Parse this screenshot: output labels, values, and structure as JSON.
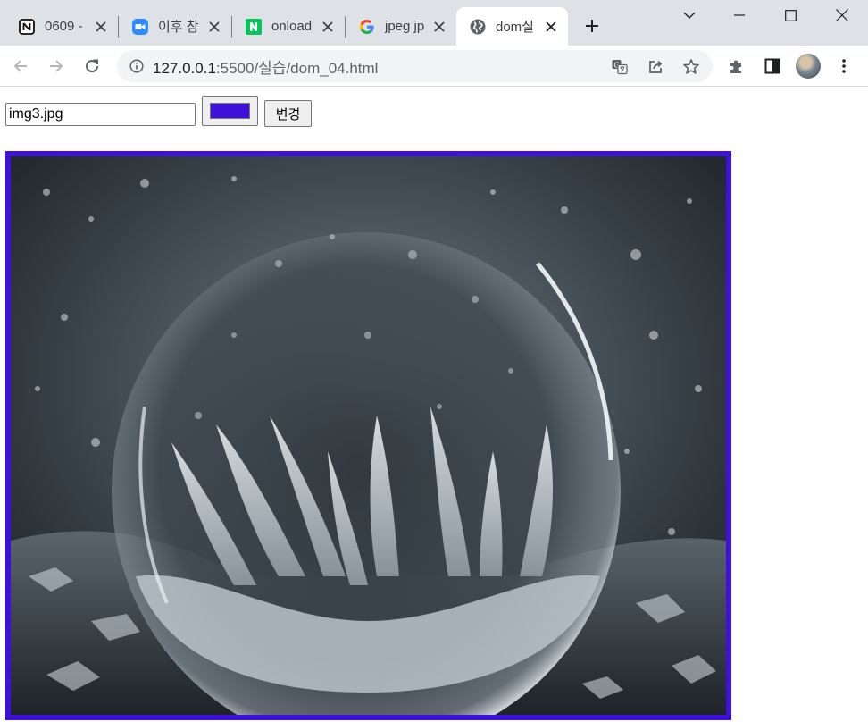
{
  "browser": {
    "tabs": [
      {
        "title": "0609 -",
        "icon": "notion-icon"
      },
      {
        "title": "이후 참",
        "icon": "zoom-icon"
      },
      {
        "title": "onload",
        "icon": "naver-icon"
      },
      {
        "title": "jpeg jp",
        "icon": "google-icon"
      },
      {
        "title": "dom실",
        "icon": "globe-icon",
        "active": true
      }
    ],
    "address": {
      "host": "127.0.0.1",
      "path": ":5500/실습/dom_04.html"
    }
  },
  "page": {
    "image_input_value": "img3.jpg",
    "border_color": "#3f10d8",
    "change_button_label": "변경"
  }
}
